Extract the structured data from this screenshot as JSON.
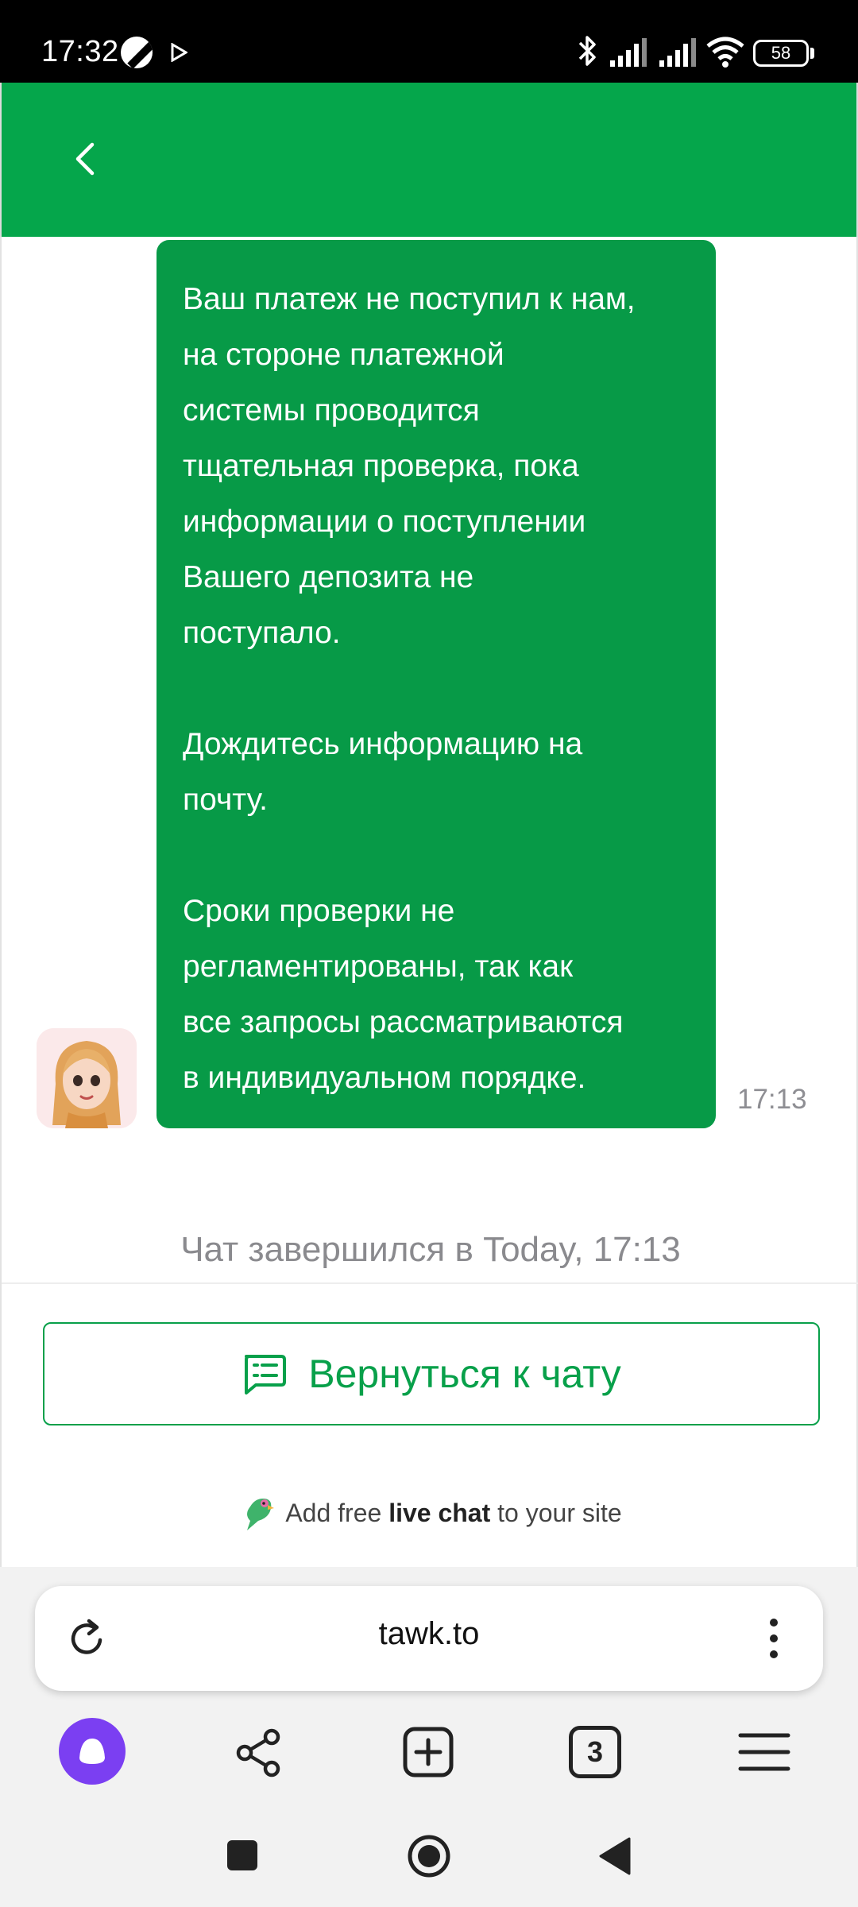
{
  "status_bar": {
    "time": "17:32",
    "battery": "58"
  },
  "header": {
    "back_icon": "chevron-left-icon"
  },
  "message": {
    "paragraphs": [
      "Ваш платеж не поступил к нам,\nна стороне платежной\nсистемы проводится\nтщательная проверка, пока\nинформации о поступлении\nВашего депозита не\nпоступало.",
      "Дождитесь информацию на\nпочту.",
      "Сроки проверки не\nрегламентированы, так как\nвсе запросы рассматриваются\nв индивидуальном порядке."
    ],
    "time": "17:13"
  },
  "chat_status": {
    "ended_text": "Чат завершился в Today, 17:13"
  },
  "return_button": {
    "label": "Вернуться к чату",
    "icon": "chat-icon"
  },
  "promo": {
    "prefix": "Add free",
    "bold": "live chat",
    "suffix": "to your site"
  },
  "browser": {
    "url": "tawk.to",
    "tabs_count": "3"
  },
  "colors": {
    "header_green": "#05a64b",
    "bubble_green": "#079a47",
    "accent_green": "#08a04a",
    "alice_purple": "#7b3ff2"
  }
}
